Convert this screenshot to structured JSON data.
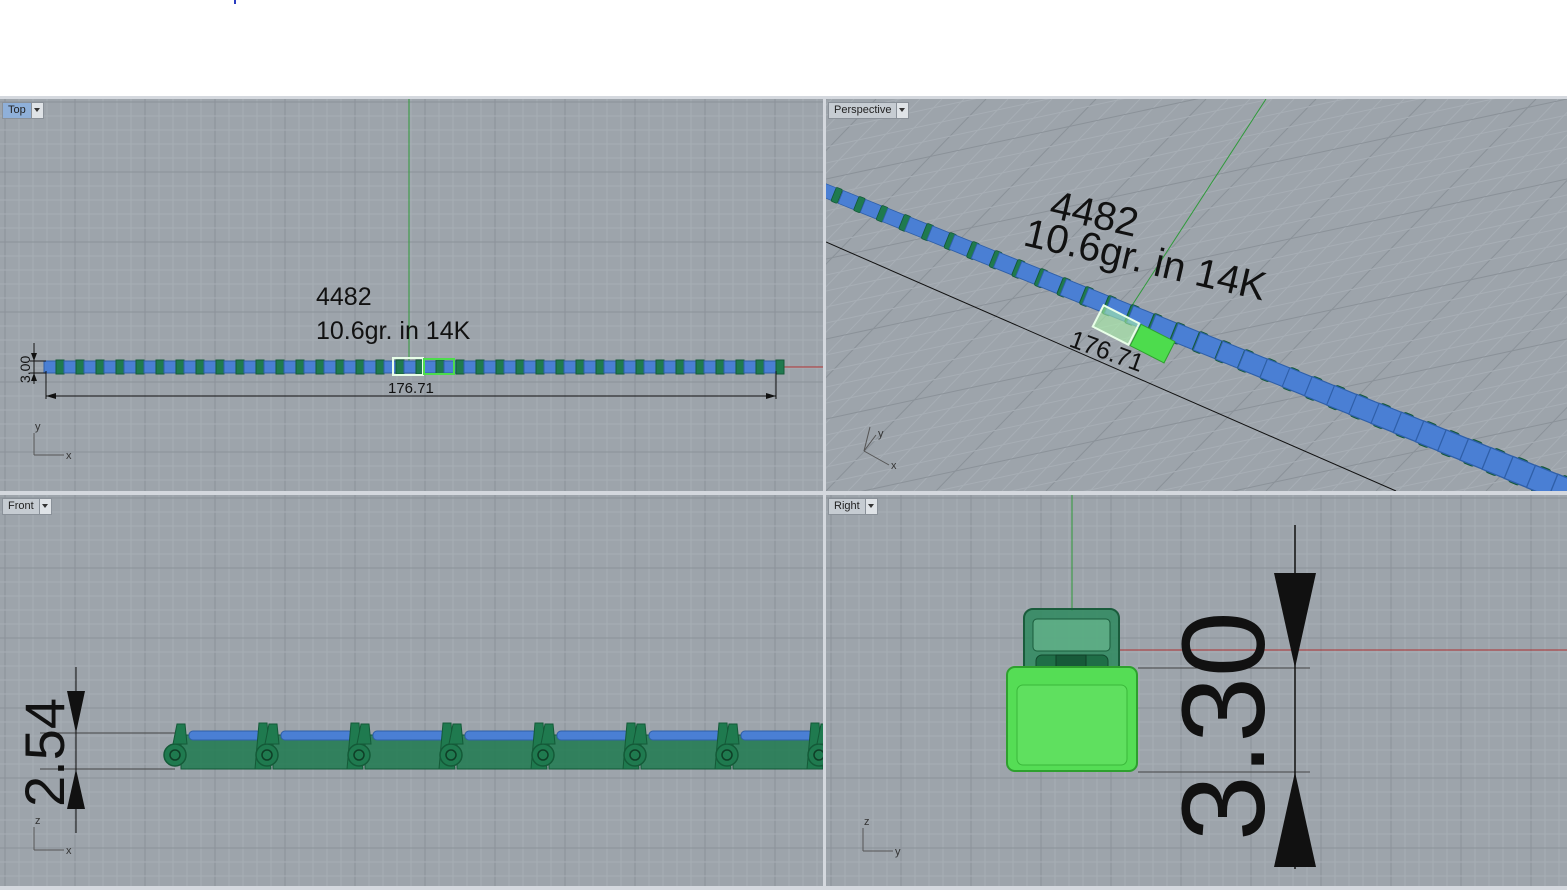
{
  "viewports": {
    "top": {
      "label": "Top",
      "part_number": "4482",
      "weight_note": "10.6gr. in 14K",
      "length_dim": "176.71",
      "width_dim": "3.00",
      "axis_a": "y",
      "axis_b": "x"
    },
    "perspective": {
      "label": "Perspective",
      "part_number": "4482",
      "weight_note": "10.6gr. in 14K",
      "length_dim": "176.71",
      "axis_a": "y",
      "axis_b": "x"
    },
    "front": {
      "label": "Front",
      "height_dim": "2.54",
      "axis_a": "z",
      "axis_b": "x"
    },
    "right": {
      "label": "Right",
      "height_dim": "3.30",
      "axis_a": "z",
      "axis_b": "y"
    }
  },
  "colors": {
    "background": "#9da4ab",
    "grid_minor": "#a7aeb5",
    "grid_major": "#8b9299",
    "link_blue": "#4a7fd4",
    "link_green": "#1f7a4f",
    "selected_green": "#4ddc4d",
    "axis_red": "#b03030",
    "axis_green": "#2f9a3a"
  }
}
